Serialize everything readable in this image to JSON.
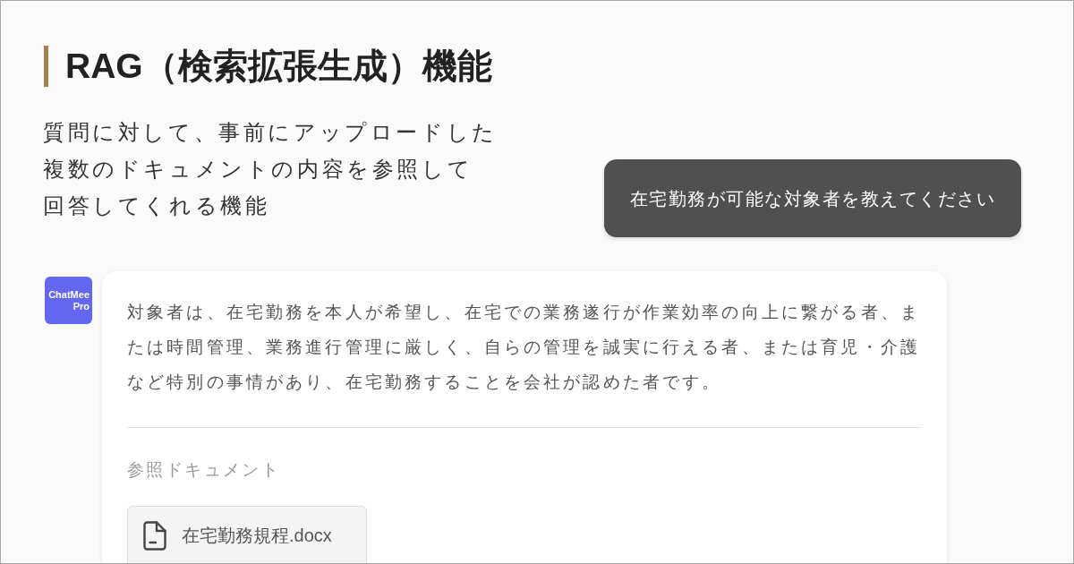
{
  "heading": {
    "title": "RAG（検索拡張生成）機能"
  },
  "description_lines": [
    "質問に対して、事前にアップロードした",
    "複数のドキュメントの内容を参照して",
    "回答してくれる機能"
  ],
  "user_message": {
    "text": "在宅勤務が可能な対象者を教えてください"
  },
  "assistant_message": {
    "avatar_logo": "ChatMee Pro",
    "text": "対象者は、在宅勤務を本人が希望し、在宅での業務遂行が作業効率の向上に繋がる者、または時間管理、業務進行管理に厳しく、自らの管理を誠実に行える者、または育児・介護など特別の事情があり、在宅勤務することを会社が認めた者です。",
    "references": {
      "label": "参照ドキュメント",
      "documents": [
        {
          "name": "在宅勤務規程.docx"
        }
      ]
    }
  }
}
